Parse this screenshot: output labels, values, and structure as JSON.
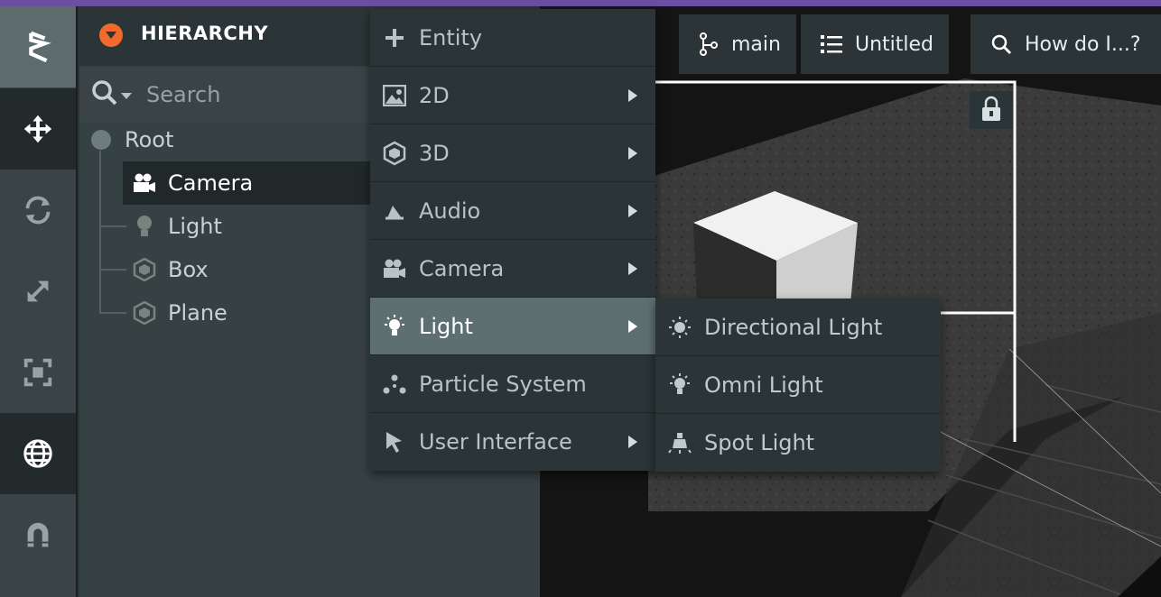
{
  "hierarchy": {
    "title": "HIERARCHY",
    "search_placeholder": "Search",
    "root": "Root",
    "children": [
      "Camera",
      "Light",
      "Box",
      "Plane"
    ]
  },
  "toolbar": {
    "tools": [
      "logo-icon",
      "translate-icon",
      "rotate-icon",
      "scale-icon",
      "resize-icon",
      "world-icon",
      "snap-icon"
    ]
  },
  "topbar": {
    "branch": "main",
    "checkpoint": "Untitled",
    "help": "How do I...?"
  },
  "menu": {
    "items": [
      {
        "label": "Entity",
        "has_submenu": false,
        "icon": "plus-icon"
      },
      {
        "label": "2D",
        "has_submenu": true,
        "icon": "image-icon"
      },
      {
        "label": "3D",
        "has_submenu": true,
        "icon": "hexagon-icon"
      },
      {
        "label": "Audio",
        "has_submenu": true,
        "icon": "audio-icon"
      },
      {
        "label": "Camera",
        "has_submenu": true,
        "icon": "camera-icon"
      },
      {
        "label": "Light",
        "has_submenu": true,
        "icon": "bulb-icon"
      },
      {
        "label": "Particle System",
        "has_submenu": false,
        "icon": "particles-icon"
      },
      {
        "label": "User Interface",
        "has_submenu": true,
        "icon": "cursor-icon"
      }
    ],
    "active": "Light"
  },
  "submenu": {
    "items": [
      "Directional Light",
      "Omni Light",
      "Spot Light"
    ]
  },
  "colors": {
    "accent": "#f26a2c",
    "top_strip": "#6b4fa3",
    "panel": "#364143",
    "menu": "#2b3436",
    "menu_active": "#5e6f72"
  }
}
